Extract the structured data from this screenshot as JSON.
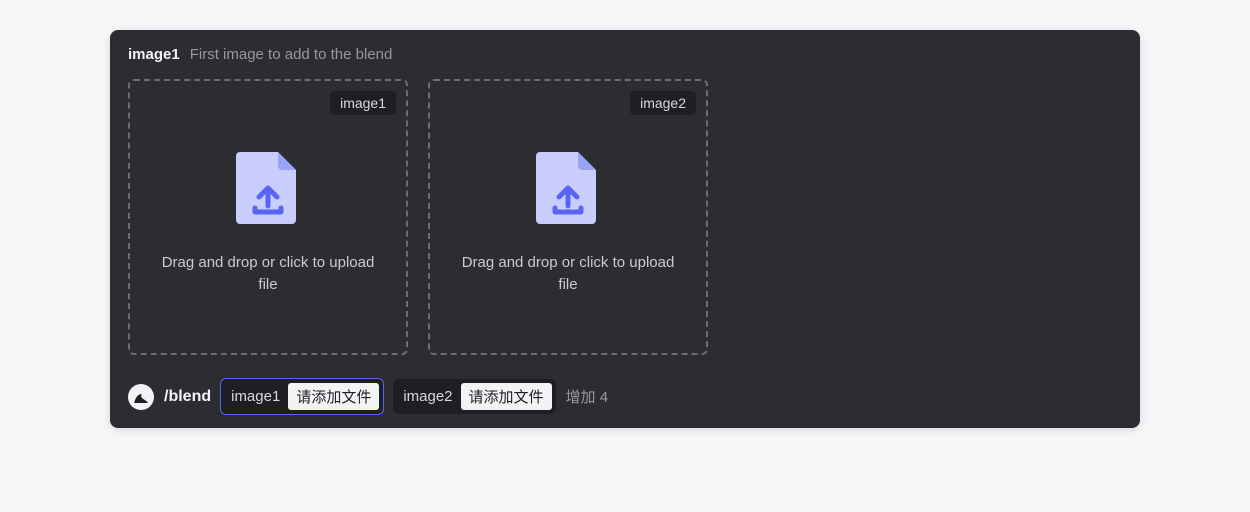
{
  "header": {
    "active_param": "image1",
    "active_param_desc": "First image to add to the blend"
  },
  "dropzones": [
    {
      "badge": "image1",
      "hint": "Drag and drop or click to upload file"
    },
    {
      "badge": "image2",
      "hint": "Drag and drop or click to upload file"
    }
  ],
  "command_bar": {
    "slash_command": "/blend",
    "pills": [
      {
        "label": "image1",
        "action": "请添加文件",
        "active": true
      },
      {
        "label": "image2",
        "action": "请添加文件",
        "active": false
      }
    ],
    "more": "增加 4"
  },
  "colors": {
    "accent": "#5865f2",
    "panel_bg": "#2b2d31",
    "dark_bg": "#1e1f22",
    "file_icon_fill": "#c9cdfb",
    "file_arrow": "#5865f2"
  }
}
